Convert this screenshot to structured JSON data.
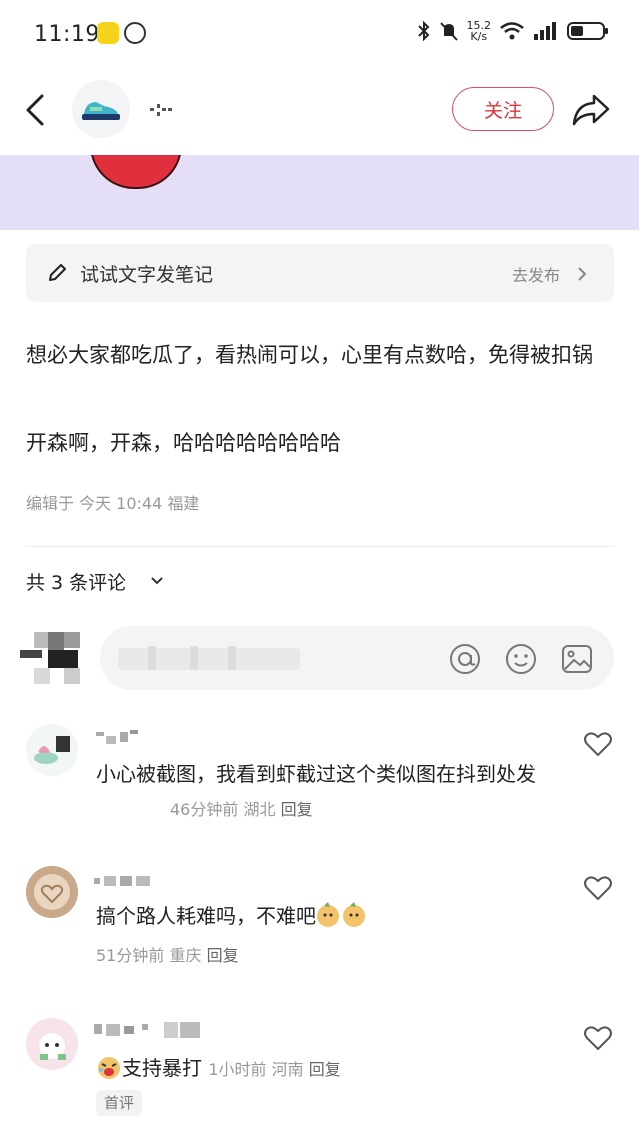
{
  "status_bar": {
    "time": "11:19",
    "net_speed_top": "15.2",
    "net_speed_unit": "K/s"
  },
  "header": {
    "follow_label": "关注"
  },
  "note_bar": {
    "label": "试试文字发笔记",
    "action": "去发布"
  },
  "post": {
    "text_1": "想必大家都吃瓜了，看热闹可以，心里有点数哈，免得被扣锅",
    "text_2": "开森啊，开森，哈哈哈哈哈哈哈哈",
    "meta": "编辑于 今天 10:44 福建"
  },
  "comments_header": {
    "label": "共 3 条评论"
  },
  "comments": [
    {
      "text": "小心被截图，我看到虾截过这个类似图在抖到处发",
      "time": "46分钟前",
      "location": "湖北",
      "reply": "回复"
    },
    {
      "text": "搞个路人耗难吗，不难吧",
      "time": "51分钟前",
      "location": "重庆",
      "reply": "回复"
    },
    {
      "text": "支持暴打",
      "time": "1小时前",
      "location": "河南",
      "reply": "回复",
      "tag": "首评"
    }
  ],
  "icons": [
    "back-icon",
    "share-icon",
    "pen-icon",
    "at-icon",
    "emoji-icon",
    "image-icon",
    "heart-icon"
  ],
  "colors": {
    "accent": "#e0303e",
    "image_bg": "#e4dff7"
  }
}
